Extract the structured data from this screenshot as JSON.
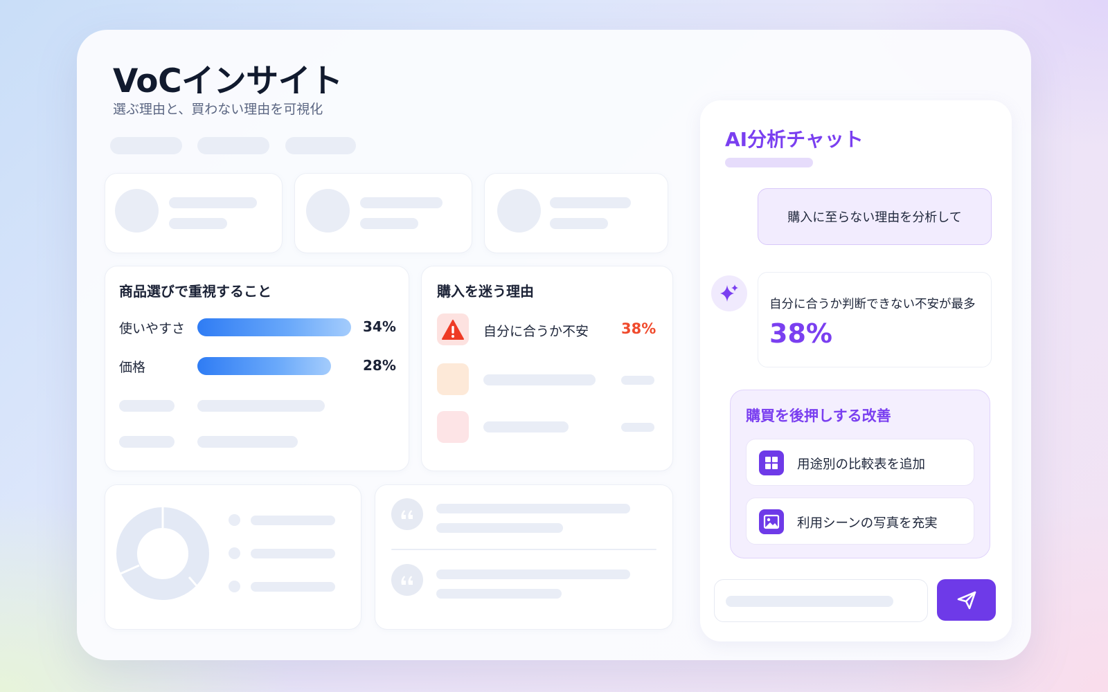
{
  "header": {
    "title": "VoCインサイト",
    "subtitle": "選ぶ理由と、買わない理由を可視化"
  },
  "priorities": {
    "title": "商品選びで重視すること",
    "items": [
      {
        "label": "使いやすさ",
        "percent": "34%",
        "value": 34
      },
      {
        "label": "価格",
        "percent": "28%",
        "value": 28
      }
    ]
  },
  "hesitation": {
    "title": "購入を迷う理由",
    "items": [
      {
        "label": "自分に合うか不安",
        "percent": "38%",
        "icon": "warning-icon"
      }
    ]
  },
  "chat": {
    "title": "AI分析チャット",
    "user_message": "購入に至らない理由を分析して",
    "ai_message": "自分に合うか判断できない不安が最多",
    "ai_value": "38%",
    "improvements_title": "購買を後押しする改善",
    "improvements": [
      {
        "label": "用途別の比較表を追加",
        "icon": "grid-icon"
      },
      {
        "label": "利用シーンの写真を充実",
        "icon": "image-icon"
      }
    ],
    "send_icon": "send-icon"
  },
  "colors": {
    "accent_purple": "#7a3ff0",
    "bar_blue": "#2f7cf4",
    "alert_red": "#f04a2c"
  }
}
